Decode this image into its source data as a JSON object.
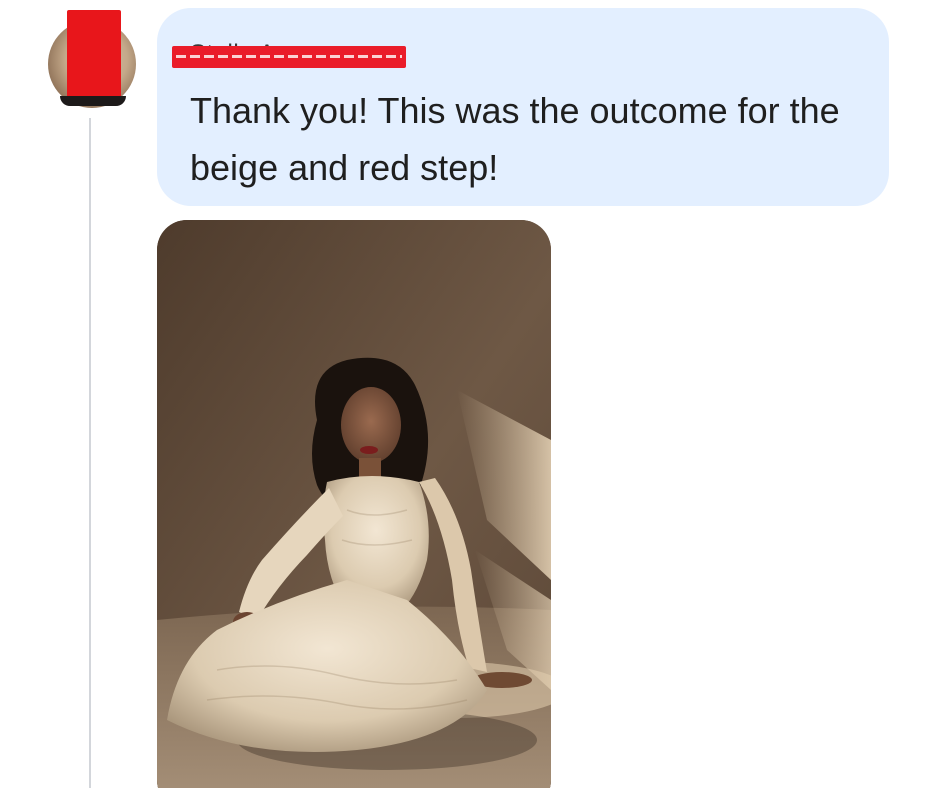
{
  "message": {
    "sender_name": "Stella A.",
    "text": "Thank you! This was the outcome for the beige and red step!"
  },
  "colors": {
    "bubble_background": "#e3efff",
    "redaction": "#e8161b",
    "thread_line": "#d3d6db"
  },
  "attachment": {
    "type": "photo",
    "subject": "woman with curly dark hair in a cream lace dress seated on the floor"
  }
}
